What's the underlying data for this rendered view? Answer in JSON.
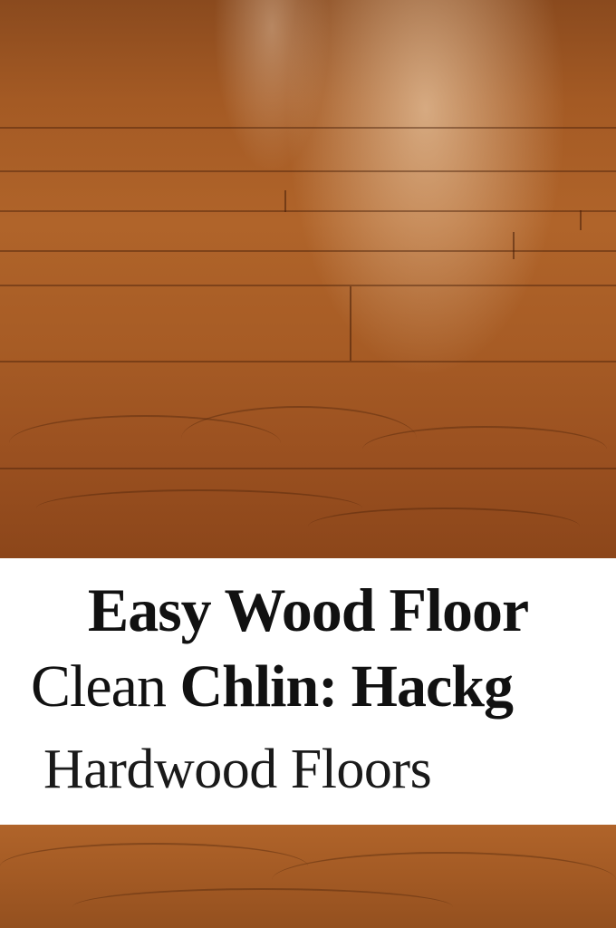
{
  "image": {
    "subject": "hardwood floor photograph",
    "colors": {
      "wood_dark": "#8a4a1e",
      "wood_mid": "#b0642a",
      "highlight": "#ffebcd",
      "caption_bg": "#ffffff",
      "text": "#111111"
    }
  },
  "caption": {
    "line1": "Easy Wood Floor",
    "line2_light": "Clean ",
    "line2_bold": "Chlin: Hackg",
    "line3": "Hardwood Floors"
  }
}
